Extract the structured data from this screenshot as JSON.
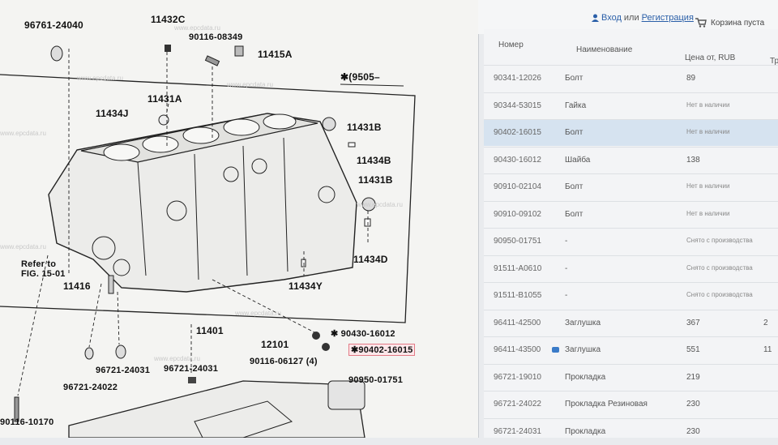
{
  "watermark": "www.epcdata.ru",
  "diagram": {
    "labels": {
      "p96761": "96761-24040",
      "p11432c": "11432C",
      "p90116a": "90116-08349",
      "p11415a": "11415A",
      "p9505": "✱(9505–",
      "p11434j": "11434J",
      "p11431a": "11431A",
      "p11431b1": "11431B",
      "p11434b": "11434B",
      "p11431b2": "11431B",
      "p11434d": "11434D",
      "p11434y": "11434Y",
      "refer1": "Refer to",
      "refer2": "FIG. 15-01",
      "p11416": "11416",
      "p11401": "11401",
      "p12101": "12101",
      "p90430": "✱ 90430-16012",
      "p90402": "✱90402-16015",
      "p90116b": "90116-06127 (4)",
      "p96721a": "96721-24031",
      "p96721b": "96721-24031",
      "p96721c": "96721-24022",
      "p90950": "90950-01751",
      "p90116c": "90116-10170"
    }
  },
  "header": {
    "login": "Вход",
    "or": "или",
    "register": "Регистрация",
    "cart": "Корзина пуста"
  },
  "table": {
    "columns": {
      "number": "Номер",
      "name": "Наименование",
      "price": "Цена от, RUB",
      "qty": "Тр"
    },
    "rows": [
      {
        "number": "90341-12026",
        "name": "Болт",
        "price": "89",
        "qty": ""
      },
      {
        "number": "90344-53015",
        "name": "Гайка",
        "price": "Нет в наличии",
        "qty": ""
      },
      {
        "number": "90402-16015",
        "name": "Болт",
        "price": "Нет в наличии",
        "qty": ""
      },
      {
        "number": "90430-16012",
        "name": "Шайба",
        "price": "138",
        "qty": ""
      },
      {
        "number": "90910-02104",
        "name": "Болт",
        "price": "Нет в наличии",
        "qty": ""
      },
      {
        "number": "90910-09102",
        "name": "Болт",
        "price": "Нет в наличии",
        "qty": ""
      },
      {
        "number": "90950-01751",
        "name": "-",
        "price": "Снято с производства",
        "qty": ""
      },
      {
        "number": "91511-A0610",
        "name": "-",
        "price": "Снято с производства",
        "qty": ""
      },
      {
        "number": "91511-B1055",
        "name": "-",
        "price": "Снято с производства",
        "qty": ""
      },
      {
        "number": "96411-42500",
        "name": "Заглушка",
        "price": "367",
        "qty": "2"
      },
      {
        "number": "96411-43500",
        "name": "Заглушка",
        "price": "551",
        "qty": "11"
      },
      {
        "number": "96721-19010",
        "name": "Прокладка",
        "price": "219",
        "qty": ""
      },
      {
        "number": "96721-24022",
        "name": "Прокладка Резиновая",
        "price": "230",
        "qty": ""
      },
      {
        "number": "96721-24031",
        "name": "Прокладка",
        "price": "230",
        "qty": ""
      }
    ],
    "selected_index": 2,
    "camera_icon_row": 10,
    "selected_color": "#d6e3f0",
    "link_color": "#2a5fa8"
  }
}
